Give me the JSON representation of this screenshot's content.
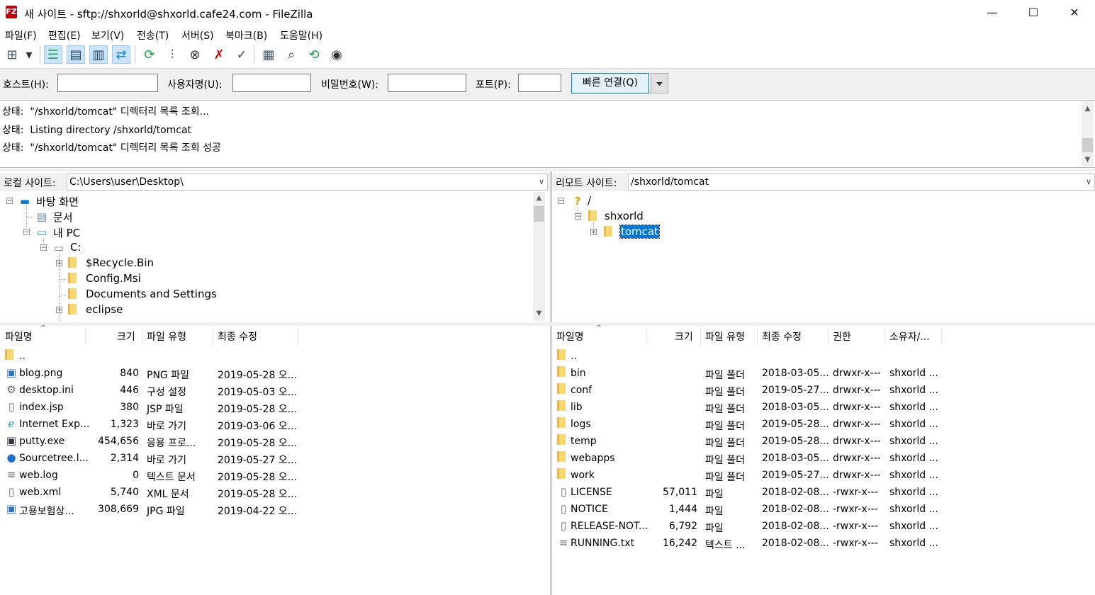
{
  "window": {
    "title": "새 사이트 - sftp://shxorld@shxorld.cafe24.com - FileZilla",
    "app_icon_glyph": "FZ",
    "controls": {
      "minimize": "—",
      "maximize": "☐",
      "close": "✕"
    }
  },
  "menu": [
    "파일(F)",
    "편집(E)",
    "보기(V)",
    "전송(T)",
    "서버(S)",
    "북마크(B)",
    "도움말(H)"
  ],
  "toolbar": {
    "icons": [
      "site-manager-icon",
      "dropdown-arrow-icon",
      "toggle-log-icon",
      "toggle-local-tree-icon",
      "toggle-remote-tree-icon",
      "toggle-queue-icon",
      "refresh-icon",
      "process-queue-icon",
      "cancel-icon",
      "disconnect-icon",
      "reconnect-icon",
      "directory-listing-filters-icon",
      "compare-icon",
      "sync-browse-icon",
      "search-icon"
    ]
  },
  "quickconnect": {
    "host_label": "호스트(H):",
    "user_label": "사용자명(U):",
    "pass_label": "비밀번호(W):",
    "port_label": "포트(P):",
    "host_value": "",
    "user_value": "",
    "pass_value": "",
    "port_value": "",
    "button": "빠른 연결(Q)"
  },
  "log": [
    "상태:  \"/shxorld/tomcat\" 디렉터리 목록 조회...",
    "상태:  Listing directory /shxorld/tomcat",
    "상태:  \"/shxorld/tomcat\" 디렉터리 목록 조회 성공"
  ],
  "local": {
    "label": "로컬 사이트:",
    "path": "C:\\Users\\user\\Desktop\\",
    "tree": [
      {
        "label": "바탕 화면",
        "icon": "desktop-icon",
        "exp": "−"
      },
      {
        "label": "문서",
        "icon": "documents-icon",
        "exp": ""
      },
      {
        "label": "내 PC",
        "icon": "computer-icon",
        "exp": "−"
      },
      {
        "label": "C:",
        "icon": "drive-icon",
        "exp": "−"
      },
      {
        "label": "$Recycle.Bin",
        "icon": "folder-icon",
        "exp": "+"
      },
      {
        "label": "Config.Msi",
        "icon": "folder-icon",
        "exp": ""
      },
      {
        "label": "Documents and Settings",
        "icon": "folder-icon",
        "exp": ""
      },
      {
        "label": "eclipse",
        "icon": "folder-icon",
        "exp": "+"
      }
    ],
    "columns": [
      "파일명",
      "크기",
      "파일 유형",
      "최종 수정"
    ],
    "files": [
      {
        "name": "..",
        "size": "",
        "type": "",
        "modified": "",
        "icon": "folder-icon"
      },
      {
        "name": "blog.png",
        "size": "840",
        "type": "PNG 파일",
        "modified": "2019-05-28 오...",
        "icon": "image-file-icon"
      },
      {
        "name": "desktop.ini",
        "size": "446",
        "type": "구성 설정",
        "modified": "2019-05-03 오...",
        "icon": "settings-file-icon"
      },
      {
        "name": "index.jsp",
        "size": "380",
        "type": "JSP 파일",
        "modified": "2019-05-28 오...",
        "icon": "file-icon"
      },
      {
        "name": "Internet Exp...",
        "size": "1,323",
        "type": "바로 가기",
        "modified": "2019-03-06 오...",
        "icon": "ie-shortcut-icon"
      },
      {
        "name": "putty.exe",
        "size": "454,656",
        "type": "응용 프로...",
        "modified": "2019-05-28 오...",
        "icon": "putty-icon"
      },
      {
        "name": "Sourcetree.l...",
        "size": "2,314",
        "type": "바로 가기",
        "modified": "2019-05-27 오...",
        "icon": "sourcetree-icon"
      },
      {
        "name": "web.log",
        "size": "0",
        "type": "텍스트 문서",
        "modified": "2019-05-28 오...",
        "icon": "text-file-icon"
      },
      {
        "name": "web.xml",
        "size": "5,740",
        "type": "XML 문서",
        "modified": "2019-05-28 오...",
        "icon": "file-icon"
      },
      {
        "name": "고용보험상...",
        "size": "308,669",
        "type": "JPG 파일",
        "modified": "2019-04-22 오...",
        "icon": "image-file-icon"
      }
    ]
  },
  "remote": {
    "label": "리모트 사이트:",
    "path": "/shxorld/tomcat",
    "tree": [
      {
        "label": "/",
        "icon": "unknown-icon",
        "exp": "−"
      },
      {
        "label": "shxorld",
        "icon": "folder-icon",
        "exp": "−"
      },
      {
        "label": "tomcat",
        "icon": "folder-icon",
        "exp": "+",
        "selected": true
      }
    ],
    "columns": [
      "파일명",
      "크기",
      "파일 유형",
      "최종 수정",
      "권한",
      "소유자/..."
    ],
    "files": [
      {
        "name": "..",
        "size": "",
        "type": "",
        "modified": "",
        "perm": "",
        "owner": "",
        "icon": "folder-icon"
      },
      {
        "name": "bin",
        "size": "",
        "type": "파일 폴더",
        "modified": "2018-03-05...",
        "perm": "drwxr-x---",
        "owner": "shxorld ...",
        "icon": "folder-icon"
      },
      {
        "name": "conf",
        "size": "",
        "type": "파일 폴더",
        "modified": "2019-05-27...",
        "perm": "drwxr-x---",
        "owner": "shxorld ...",
        "icon": "folder-icon"
      },
      {
        "name": "lib",
        "size": "",
        "type": "파일 폴더",
        "modified": "2018-03-05...",
        "perm": "drwxr-x---",
        "owner": "shxorld ...",
        "icon": "folder-icon"
      },
      {
        "name": "logs",
        "size": "",
        "type": "파일 폴더",
        "modified": "2019-05-28...",
        "perm": "drwxr-x---",
        "owner": "shxorld ...",
        "icon": "folder-icon"
      },
      {
        "name": "temp",
        "size": "",
        "type": "파일 폴더",
        "modified": "2019-05-28...",
        "perm": "drwxr-x---",
        "owner": "shxorld ...",
        "icon": "folder-icon"
      },
      {
        "name": "webapps",
        "size": "",
        "type": "파일 폴더",
        "modified": "2018-03-05...",
        "perm": "drwxr-x---",
        "owner": "shxorld ...",
        "icon": "folder-icon"
      },
      {
        "name": "work",
        "size": "",
        "type": "파일 폴더",
        "modified": "2019-05-27...",
        "perm": "drwxr-x---",
        "owner": "shxorld ...",
        "icon": "folder-icon"
      },
      {
        "name": "LICENSE",
        "size": "57,011",
        "type": "파일",
        "modified": "2018-02-08...",
        "perm": "-rwxr-x---",
        "owner": "shxorld ...",
        "icon": "file-icon"
      },
      {
        "name": "NOTICE",
        "size": "1,444",
        "type": "파일",
        "modified": "2018-02-08...",
        "perm": "-rwxr-x---",
        "owner": "shxorld ...",
        "icon": "file-icon"
      },
      {
        "name": "RELEASE-NOT...",
        "size": "6,792",
        "type": "파일",
        "modified": "2018-02-08...",
        "perm": "-rwxr-x---",
        "owner": "shxorld ...",
        "icon": "file-icon"
      },
      {
        "name": "RUNNING.txt",
        "size": "16,242",
        "type": "텍스트 ...",
        "modified": "2018-02-08...",
        "perm": "-rwxr-x---",
        "owner": "shxorld ...",
        "icon": "text-file-icon"
      }
    ]
  },
  "colors": {
    "selection": "#0078d7",
    "folder": "#f8d775",
    "accent": "#0078d7"
  }
}
